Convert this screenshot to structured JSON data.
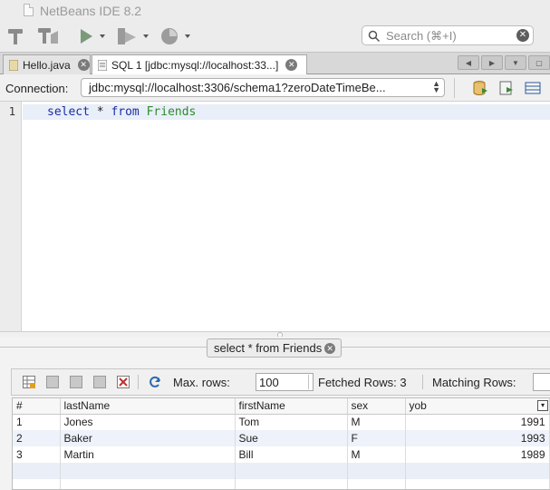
{
  "window": {
    "title": "NetBeans IDE 8.2"
  },
  "toolbar": {
    "buttons": [
      {
        "name": "build-icon"
      },
      {
        "name": "clean-build-icon"
      },
      {
        "name": "run-icon"
      },
      {
        "name": "debug-icon"
      },
      {
        "name": "profile-icon"
      }
    ],
    "search": {
      "placeholder": "Search (⌘+I)"
    }
  },
  "tabs": [
    {
      "label": "Hello.java",
      "active": false
    },
    {
      "label": "SQL 1 [jdbc:mysql://localhost:33...]",
      "active": true
    }
  ],
  "connection": {
    "label": "Connection:",
    "value": "jdbc:mysql://localhost:3306/schema1?zeroDateTimeBe..."
  },
  "editor": {
    "line_number": "1",
    "tokens": [
      {
        "text": "select",
        "kind": "kw"
      },
      {
        "text": " * ",
        "kind": "plain"
      },
      {
        "text": "from",
        "kind": "kw"
      },
      {
        "text": " ",
        "kind": "plain"
      },
      {
        "text": "Friends",
        "kind": "ident"
      }
    ]
  },
  "results": {
    "tab_label": "select * from Friends",
    "max_rows_label": "Max. rows:",
    "max_rows_value": "100",
    "fetched_rows_label": "Fetched Rows: 3",
    "matching_rows_label": "Matching Rows:",
    "columns": [
      "#",
      "lastName",
      "firstName",
      "sex",
      "yob"
    ],
    "rows": [
      [
        "1",
        "Jones",
        "Tom",
        "M",
        "1991"
      ],
      [
        "2",
        "Baker",
        "Sue",
        "F",
        "1993"
      ],
      [
        "3",
        "Martin",
        "Bill",
        "M",
        "1989"
      ]
    ]
  },
  "colors": {
    "keyword": "#1a2ea0",
    "identifier": "#2e8b2e",
    "current_line": "#e9eff8",
    "alt_row": "#eef2fa"
  }
}
